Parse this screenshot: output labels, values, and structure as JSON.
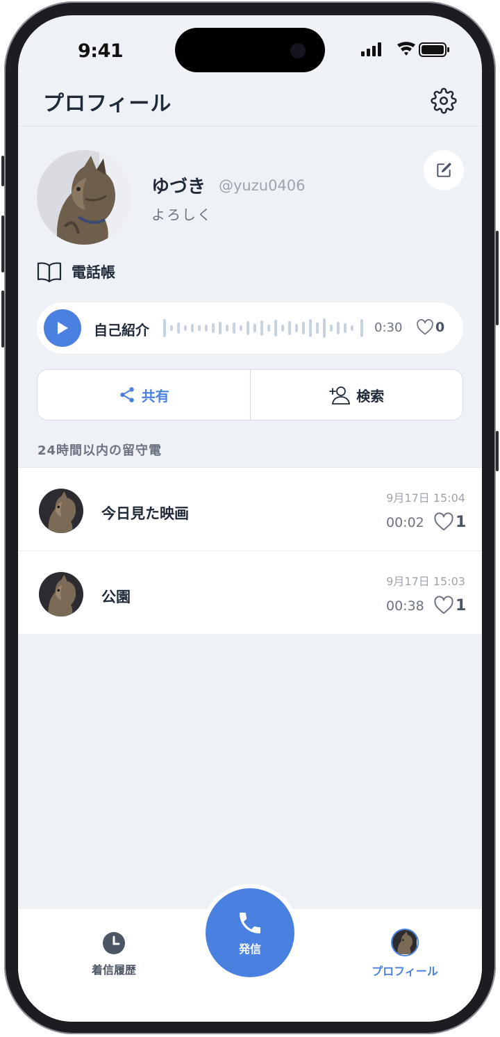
{
  "status_bar": {
    "time": "9:41"
  },
  "header": {
    "title": "プロフィール"
  },
  "profile": {
    "display_name": "ゆづき",
    "handle": "@yuzu0406",
    "bio": "よろしく",
    "phonebook_label": "電話帳"
  },
  "intro": {
    "label": "自己紹介",
    "duration": "0:30",
    "likes": "0"
  },
  "actions": {
    "share_label": "共有",
    "search_label": "検索"
  },
  "voicemail_section": {
    "title": "24時間以内の留守電",
    "items": [
      {
        "title": "今日見た映画",
        "date": "9月17日 15:04",
        "duration": "00:02",
        "likes": "1"
      },
      {
        "title": "公園",
        "date": "9月17日 15:03",
        "duration": "00:38",
        "likes": "1"
      }
    ]
  },
  "tabbar": {
    "history_label": "着信履歴",
    "call_label": "発信",
    "profile_label": "プロフィール"
  },
  "colors": {
    "accent": "#4a80e0",
    "background": "#eef2f7",
    "text": "#1f2937"
  }
}
